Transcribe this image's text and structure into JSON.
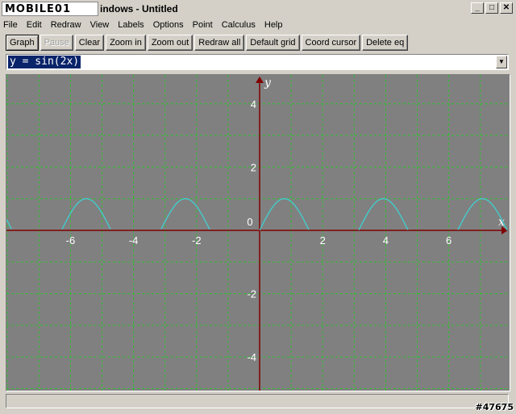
{
  "window": {
    "logo_text": "MOBILE01",
    "title": "indows - Untitled",
    "controls": {
      "minimize": "_",
      "maximize": "□",
      "close": "✕"
    }
  },
  "menu": [
    "File",
    "Edit",
    "Redraw",
    "View",
    "Labels",
    "Options",
    "Point",
    "Calculus",
    "Help"
  ],
  "toolbar": {
    "graph": "Graph",
    "pause": "Pause",
    "clear": "Clear",
    "zoom_in": "Zoom in",
    "zoom_out": "Zoom out",
    "redraw_all": "Redraw all",
    "default_grid": "Default grid",
    "coord_cursor": "Coord cursor",
    "delete_eq": "Delete eq"
  },
  "equation": {
    "value": "y = sin(2x)",
    "dropdown_icon": "triangle-down-icon"
  },
  "chart_data": {
    "type": "line",
    "function": "sin(2x)",
    "xlabel": "x",
    "ylabel": "y",
    "xlim": [
      -8,
      8
    ],
    "ylim": [
      -5.3,
      5
    ],
    "x_tick_labels": [
      "-6",
      "-4",
      "-2",
      "0",
      "2",
      "4",
      "6"
    ],
    "x_tick_values": [
      -6,
      -4,
      -2,
      0,
      2,
      4,
      6
    ],
    "y_tick_labels": [
      "4",
      "2",
      "-2",
      "-4"
    ],
    "y_tick_values": [
      4,
      2,
      -2,
      -4
    ],
    "grid": true,
    "colors": {
      "background": "#808080",
      "grid": "#2ec42e",
      "axes": "#800000",
      "curve": "#40d0d0",
      "labels": "#ffffff"
    }
  },
  "status": {
    "text": ""
  },
  "watermark": "#47675"
}
